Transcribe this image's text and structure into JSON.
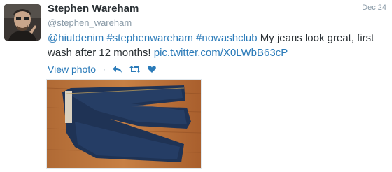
{
  "tweet": {
    "display_name": "Stephen Wareham",
    "handle": "@stephen_wareham",
    "timestamp": "Dec 24",
    "hashtag_1": "@hiutdenim",
    "hashtag_2": "#stephenwareham",
    "hashtag_3": "#nowashclub",
    "text_plain": "My jeans look great, first wash after 12 months!",
    "link": "pic.twitter.com/X0LWbB63cP"
  },
  "actions": {
    "view_photo": "View photo",
    "separator": "·",
    "reply_icon": "reply-icon",
    "retweet_icon": "retweet-icon",
    "favorite_icon": "heart-icon"
  },
  "colors": {
    "link": "#2b7bb9",
    "name": "#292f33",
    "meta": "#8899a6"
  }
}
